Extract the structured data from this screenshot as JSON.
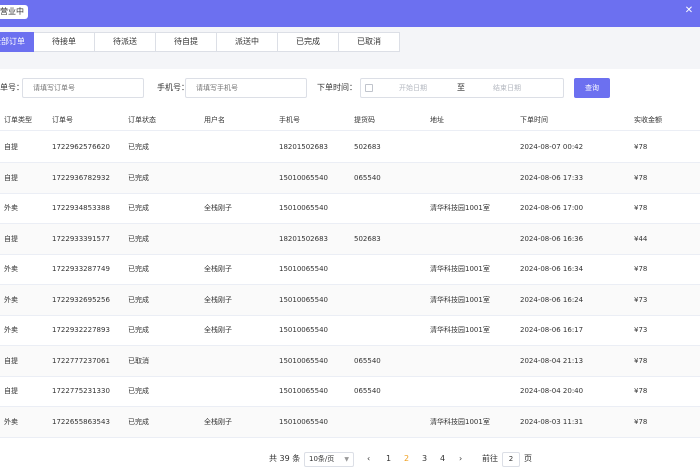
{
  "header": {
    "status": "营业中"
  },
  "tabs": [
    "全部订单",
    "待接单",
    "待派送",
    "待自提",
    "派送中",
    "已完成",
    "已取消"
  ],
  "filters": {
    "order_no_label": "订单号：",
    "order_no_placeholder": "请填写订单号",
    "phone_label": "手机号：",
    "phone_placeholder": "请填写手机号",
    "time_label": "下单时间：",
    "start_placeholder": "开始日期",
    "separator": "至",
    "end_placeholder": "结束日期",
    "query_label": "查询"
  },
  "table": {
    "columns": [
      "订单类型",
      "订单号",
      "订单状态",
      "用户名",
      "手机号",
      "提货码",
      "地址",
      "下单时间",
      "实收金额"
    ],
    "rows": [
      [
        "自提",
        "1722962576620",
        "已完成",
        "",
        "18201502683",
        "502683",
        "",
        "2024-08-07 00:42",
        "¥78"
      ],
      [
        "自提",
        "1722936782932",
        "已完成",
        "",
        "15010065540",
        "065540",
        "",
        "2024-08-06 17:33",
        "¥78"
      ],
      [
        "外卖",
        "1722934853388",
        "已完成",
        "全栈刚子",
        "15010065540",
        "",
        "清华科技园1001室",
        "2024-08-06 17:00",
        "¥78"
      ],
      [
        "自提",
        "1722933391577",
        "已完成",
        "",
        "18201502683",
        "502683",
        "",
        "2024-08-06 16:36",
        "¥44"
      ],
      [
        "外卖",
        "1722933287749",
        "已完成",
        "全栈刚子",
        "15010065540",
        "",
        "清华科技园1001室",
        "2024-08-06 16:34",
        "¥78"
      ],
      [
        "外卖",
        "1722932695256",
        "已完成",
        "全栈刚子",
        "15010065540",
        "",
        "清华科技园1001室",
        "2024-08-06 16:24",
        "¥73"
      ],
      [
        "外卖",
        "1722932227893",
        "已完成",
        "全栈刚子",
        "15010065540",
        "",
        "清华科技园1001室",
        "2024-08-06 16:17",
        "¥73"
      ],
      [
        "自提",
        "1722777237061",
        "已取消",
        "",
        "15010065540",
        "065540",
        "",
        "2024-08-04 21:13",
        "¥78"
      ],
      [
        "自提",
        "1722775231330",
        "已完成",
        "",
        "15010065540",
        "065540",
        "",
        "2024-08-04 20:40",
        "¥78"
      ],
      [
        "外卖",
        "1722655863543",
        "已完成",
        "全栈刚子",
        "15010065540",
        "",
        "清华科技园1001室",
        "2024-08-03 11:31",
        "¥78"
      ]
    ]
  },
  "pagination": {
    "total": "共 39 条",
    "page_size": "10条/页",
    "prev": "‹",
    "next": "›",
    "pages": [
      "1",
      "2",
      "3",
      "4"
    ],
    "current": "2",
    "goto_label": "前往",
    "goto_value": "2",
    "goto_suffix": "页"
  }
}
